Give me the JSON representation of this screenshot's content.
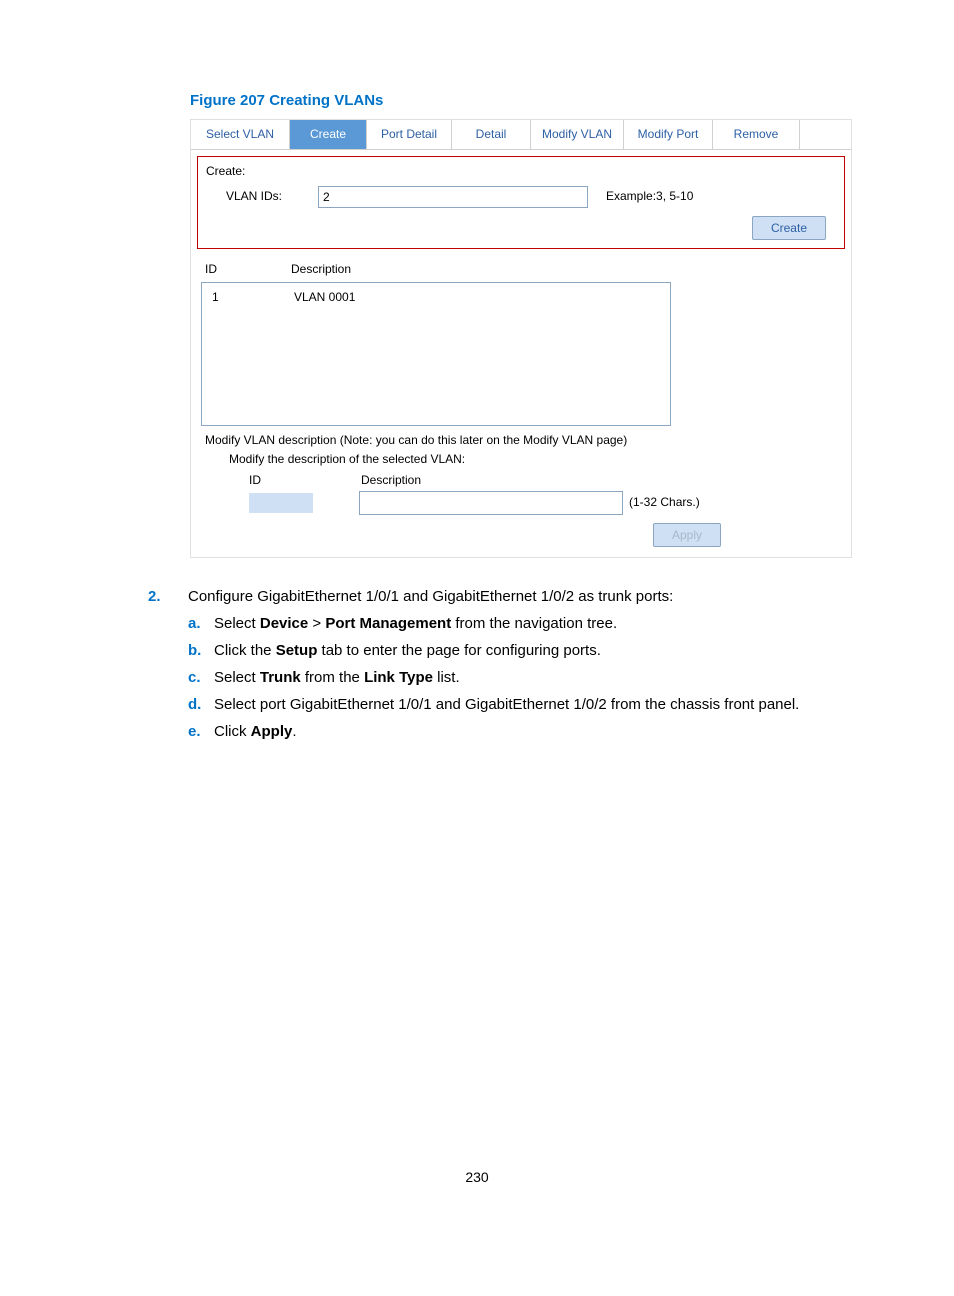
{
  "figure_caption": "Figure 207 Creating VLANs",
  "tabs": {
    "t1": "Select VLAN",
    "t2": "Create",
    "t3": "Port Detail",
    "t4": "Detail",
    "t5": "Modify VLAN",
    "t6": "Modify Port",
    "t7": "Remove"
  },
  "create": {
    "title": "Create:",
    "label": "VLAN IDs:",
    "value": "2",
    "hint": "Example:3, 5-10",
    "btn": "Create"
  },
  "list": {
    "hdr_id": "ID",
    "hdr_desc": "Description",
    "row_id": "1",
    "row_desc": "VLAN 0001"
  },
  "modify": {
    "note": "Modify VLAN description (Note: you can do this later on the Modify VLAN page)",
    "note2": "Modify the description of the selected VLAN:",
    "hdr_id": "ID",
    "hdr_desc": "Description",
    "chint": "(1-32 Chars.)",
    "apply": "Apply"
  },
  "step": {
    "num": "2.",
    "text_a": "Configure GigabitEthernet 1/0/1 and GigabitEthernet 1/0/2 as trunk ports:",
    "a": {
      "lab": "a.",
      "pre": "Select ",
      "b1": "Device",
      "mid": " > ",
      "b2": "Port Management",
      "post": " from the navigation tree."
    },
    "b": {
      "lab": "b.",
      "pre": "Click the ",
      "b1": "Setup",
      "post": " tab to enter the page for configuring ports."
    },
    "c": {
      "lab": "c.",
      "pre": "Select ",
      "b1": "Trunk",
      "mid": " from the ",
      "b2": "Link Type",
      "post": " list."
    },
    "d": {
      "lab": "d.",
      "text": "Select port GigabitEthernet 1/0/1 and GigabitEthernet 1/0/2 from the chassis front panel."
    },
    "e": {
      "lab": "e.",
      "pre": "Click ",
      "b1": "Apply",
      "post": "."
    }
  },
  "page_number": "230"
}
